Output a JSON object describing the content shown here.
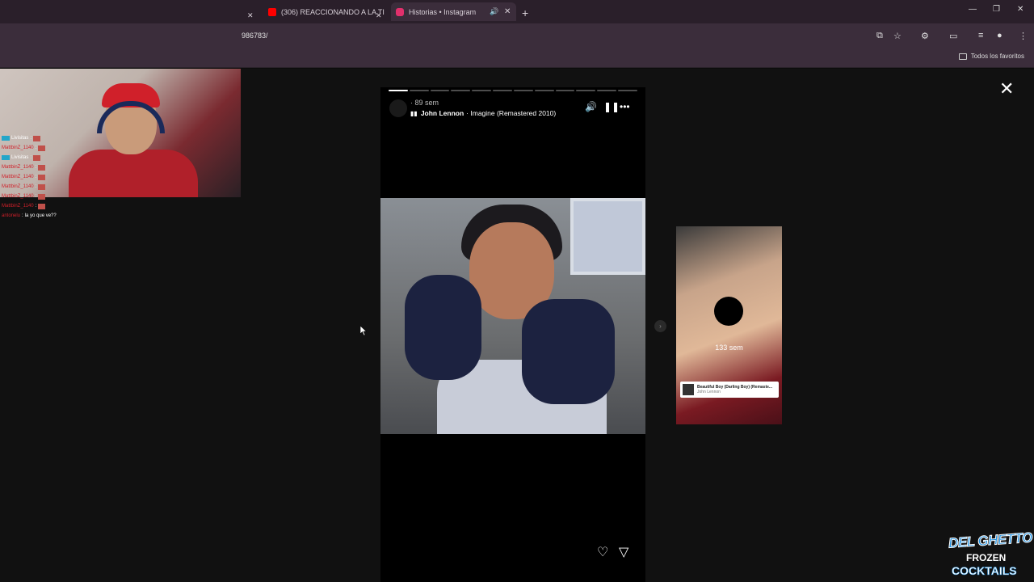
{
  "browser": {
    "tabs": [
      {
        "title": "(306) REACCIONANDO A LA TI",
        "favicon": "youtube-icon",
        "color": "#ff0000"
      },
      {
        "title": "Historias • Instagram",
        "favicon": "instagram-icon",
        "color": "#e1306c"
      }
    ],
    "url": "986783/",
    "bookmarks_label": "Todos los favoritos"
  },
  "chat": {
    "messages": [
      {
        "user": "Livisitas",
        "text": "",
        "user_color": "#ffffff"
      },
      {
        "user": "MattbinZ_1140",
        "text": "",
        "user_color": "#d0202a"
      },
      {
        "user": "Livisitas",
        "text": "",
        "user_color": "#ffffff"
      },
      {
        "user": "MattbinZ_1140",
        "text": "",
        "user_color": "#d0202a"
      },
      {
        "user": "MattbinZ_1140",
        "text": "",
        "user_color": "#d0202a"
      },
      {
        "user": "MattbinZ_1140",
        "text": "",
        "user_color": "#d0202a"
      },
      {
        "user": "MattbinZ_1140",
        "text": "",
        "user_color": "#d0202a"
      },
      {
        "user": "MattbinZ_1140",
        "text": "",
        "user_color": "#d0202a"
      },
      {
        "user": "antonelu",
        "text": "la yo que ve??",
        "user_color": "#d0202a"
      }
    ]
  },
  "story": {
    "time_ago": "89 sem",
    "song_artist": "John Lennon",
    "song_title": "Imagine (Remastered 2010)",
    "progress_segments": 12,
    "progress_current": 1
  },
  "next_story": {
    "time_ago": "133 sem",
    "music_title": "Beautiful Boy (Darling Boy) (Remaste...",
    "music_artist": "John Lennon"
  },
  "sponsor": {
    "line1": "DEL GHETTO",
    "line2": "FROZEN",
    "line3": "COCKTAILS"
  }
}
